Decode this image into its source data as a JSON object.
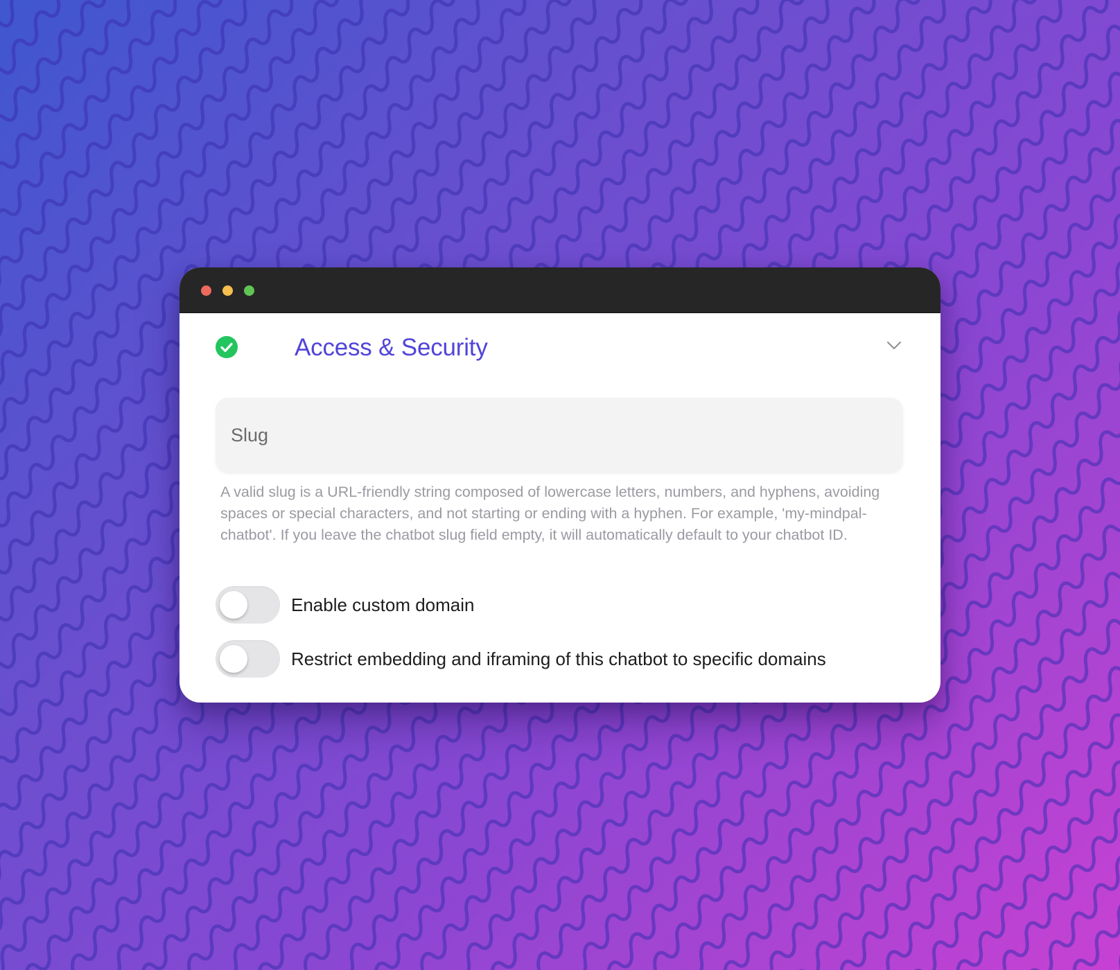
{
  "colors": {
    "background_start": "#3f57cf",
    "background_end": "#c741d3",
    "titlebar": "#262626",
    "traffic_close": "#ed6a5e",
    "traffic_minimize": "#f5bf4f",
    "traffic_zoom": "#61c554",
    "accent": "#5144d8",
    "success": "#22c55e",
    "toggle_off": "#e5e5e7"
  },
  "window": {
    "controls": [
      {
        "name": "close",
        "icon": "traffic-light-close"
      },
      {
        "name": "minimize",
        "icon": "traffic-light-minimize"
      },
      {
        "name": "zoom",
        "icon": "traffic-light-zoom"
      }
    ]
  },
  "section": {
    "icon": "check-circle-icon",
    "title": "Access & Security",
    "expanded": true,
    "toggle_icon": "chevron-down-icon"
  },
  "slug": {
    "placeholder": "Slug",
    "value": "",
    "help_text": "A valid slug is a URL-friendly string composed of lowercase letters, numbers, and hyphens, avoiding spaces or special characters, and not starting or ending with a hyphen. For example, 'my-mindpal-chatbot'. If you leave the chatbot slug field empty, it will automatically default to your chatbot ID."
  },
  "toggles": [
    {
      "label": "Enable custom domain",
      "enabled": false
    },
    {
      "label": "Restrict embedding and iframing of this chatbot to specific domains",
      "enabled": false
    }
  ]
}
